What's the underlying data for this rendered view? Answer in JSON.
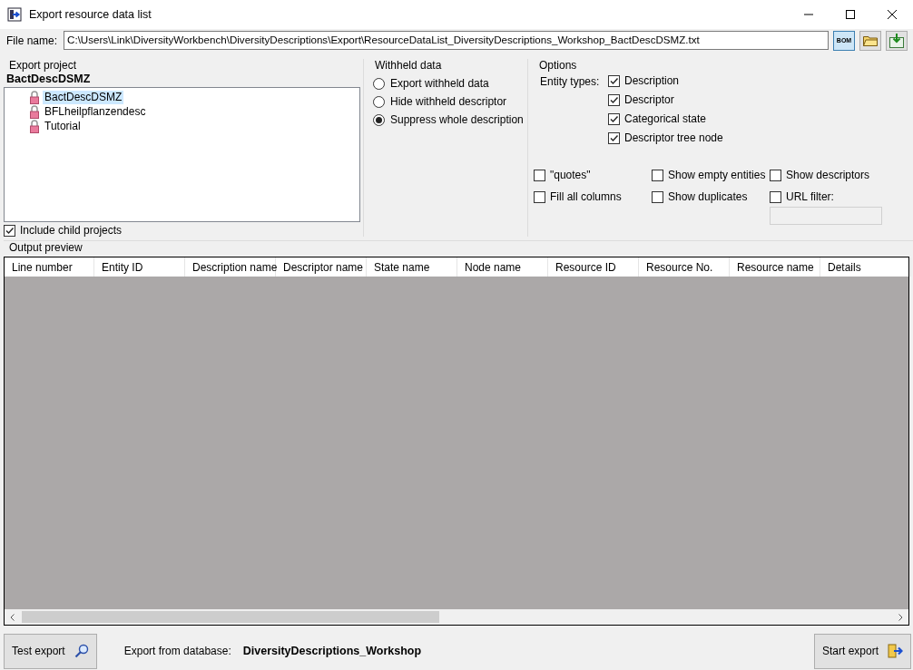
{
  "window": {
    "title": "Export resource data list"
  },
  "file": {
    "label": "File name:",
    "value": "C:\\Users\\Link\\DiversityWorkbench\\DiversityDescriptions\\Export\\ResourceDataList_DiversityDescriptions_Workshop_BactDescDSMZ.txt",
    "bom_button": "BOM"
  },
  "export_project": {
    "title": "Export project",
    "current": "BactDescDSMZ",
    "projects": [
      {
        "name": "BactDescDSMZ",
        "selected": true
      },
      {
        "name": "BFLheilpflanzendesc",
        "selected": false
      },
      {
        "name": "Tutorial",
        "selected": false
      }
    ],
    "include_child": {
      "label": "Include child projects",
      "checked": true
    }
  },
  "withheld": {
    "title": "Withheld data",
    "options": [
      {
        "label": "Export withheld data",
        "selected": false
      },
      {
        "label": "Hide withheld descriptor",
        "selected": false
      },
      {
        "label": "Suppress whole description",
        "selected": true
      }
    ]
  },
  "options": {
    "title": "Options",
    "entity_label": "Entity types:",
    "entity_types": [
      {
        "label": "Description",
        "checked": true
      },
      {
        "label": "Descriptor",
        "checked": true
      },
      {
        "label": "Categorical state",
        "checked": true
      },
      {
        "label": "Descriptor tree node",
        "checked": true
      }
    ],
    "flags": [
      {
        "label": "\"quotes\"",
        "checked": false
      },
      {
        "label": "Show empty entities",
        "checked": false
      },
      {
        "label": "Show descriptors",
        "checked": false
      },
      {
        "label": "Fill all columns",
        "checked": false
      },
      {
        "label": "Show duplicates",
        "checked": false
      },
      {
        "label": "URL filter:",
        "checked": false
      }
    ]
  },
  "preview": {
    "title": "Output preview",
    "columns": [
      "Line number",
      "Entity ID",
      "Description name",
      "Descriptor name",
      "State name",
      "Node name",
      "Resource ID",
      "Resource No.",
      "Resource name",
      "Details"
    ]
  },
  "footer": {
    "test_button": "Test export",
    "db_label": "Export from database:",
    "db_name": "DiversityDescriptions_Workshop",
    "start_button": "Start export"
  }
}
